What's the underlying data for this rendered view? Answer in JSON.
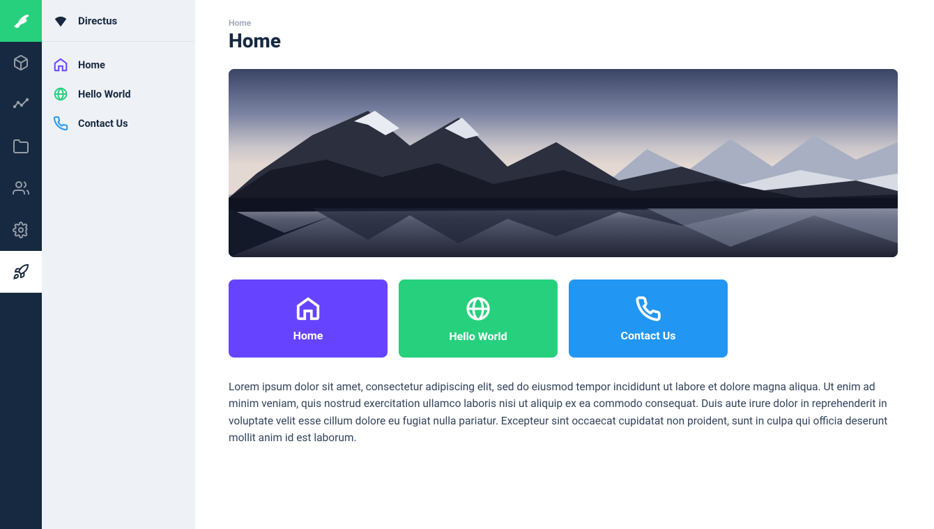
{
  "project": {
    "name": "Directus"
  },
  "nav": {
    "items": [
      {
        "label": "Home",
        "icon": "home-icon",
        "icon_color": "#6644ff"
      },
      {
        "label": "Hello World",
        "icon": "globe-icon",
        "icon_color": "#26d07c"
      },
      {
        "label": "Contact Us",
        "icon": "phone-icon",
        "icon_color": "#2196f3"
      }
    ]
  },
  "breadcrumb": "Home",
  "page": {
    "title": "Home"
  },
  "cards": [
    {
      "label": "Home",
      "bg": "#6644ff",
      "icon": "home-icon"
    },
    {
      "label": "Hello World",
      "bg": "#26d07c",
      "icon": "globe-icon"
    },
    {
      "label": "Contact Us",
      "bg": "#2196f3",
      "icon": "phone-icon"
    }
  ],
  "body_text": "Lorem ipsum dolor sit amet, consectetur adipiscing elit, sed do eiusmod tempor incididunt ut labore et dolore magna aliqua. Ut enim ad minim veniam, quis nostrud exercitation ullamco laboris nisi ut aliquip ex ea commodo consequat. Duis aute irure dolor in reprehenderit in voluptate velit esse cillum dolore eu fugiat nulla pariatur. Excepteur sint occaecat cupidatat non proident, sunt in culpa qui officia deserunt mollit anim id est laborum.",
  "module_bar": {
    "items": [
      {
        "name": "content-module",
        "icon": "box-icon"
      },
      {
        "name": "insights-module",
        "icon": "chart-icon"
      },
      {
        "name": "files-module",
        "icon": "folder-icon"
      },
      {
        "name": "users-module",
        "icon": "people-icon"
      },
      {
        "name": "settings-module",
        "icon": "gear-icon"
      }
    ],
    "bottom": {
      "name": "launch-module",
      "icon": "rocket-icon"
    }
  }
}
